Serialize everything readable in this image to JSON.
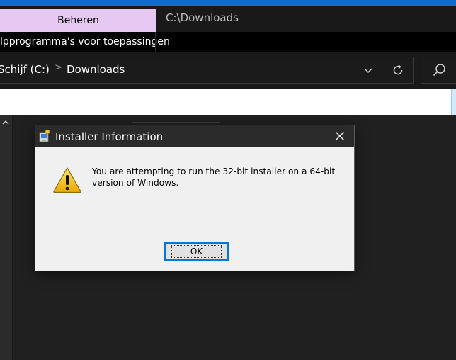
{
  "ribbon": {
    "manage_tab": "Beheren",
    "window_title": "C:\\Downloads",
    "context_label": "lpprogramma's voor toepassingen"
  },
  "address_bar": {
    "crumbs": [
      "Schijf (C:)",
      "Downloads"
    ],
    "separator": ">",
    "dropdown_icon": "chevron-down-icon",
    "refresh_icon": "refresh-icon",
    "search_icon": "search-icon"
  },
  "dialog": {
    "title": "Installer Information",
    "message": "You are attempting to run the 32-bit installer on a 64-bit version of Windows.",
    "ok_label": "OK",
    "close_symbol": "✕",
    "icon": "warning-icon"
  },
  "colors": {
    "accent_blue": "#0d6ecf",
    "manage_tab_bg": "#e6c8f3",
    "ok_border": "#0078d7",
    "dark_bg": "#202020"
  }
}
